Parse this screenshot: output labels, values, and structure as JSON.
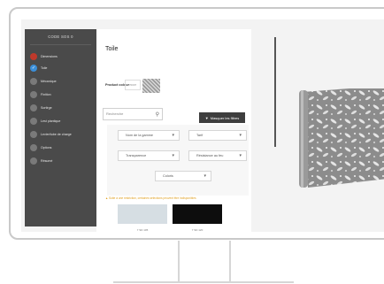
{
  "sidebar": {
    "title": "CODE SOS 0",
    "steps": [
      {
        "label": "Dimensions",
        "state": "done"
      },
      {
        "label": "Toile",
        "state": "active"
      },
      {
        "label": "Mécanique",
        "state": "todo"
      },
      {
        "label": "Finition",
        "state": "todo"
      },
      {
        "label": "Sortirge",
        "state": "todo"
      },
      {
        "label": "Lest plantique",
        "state": "todo"
      },
      {
        "label": "Levier/tube de charge",
        "state": "todo"
      },
      {
        "label": "Options",
        "state": "todo"
      },
      {
        "label": "Résumé",
        "state": "todo"
      }
    ]
  },
  "main": {
    "title": "Toile",
    "product_colour_label": "Product colour",
    "product_colour_value": "70007",
    "search_placeholder": "Recherche",
    "mask_filters_label": "Masquer les filtres",
    "filters": {
      "gamme": "Nom de la gamme",
      "tarif": "Tarif",
      "transparence": "Transparence",
      "feu": "Résistance au feu",
      "coloris": "Coloris"
    },
    "alert_text": "Suite à une restriction, certaines sélections peuvent être indisponibles",
    "fabrics": [
      {
        "label": "7 SD 105",
        "color": "#d6dee3"
      },
      {
        "label": "7 SD 120",
        "color": "#0d0d0d"
      }
    ]
  },
  "colors": {
    "sidebar": "#4a4a4a",
    "active_step": "#3b8fd9",
    "done_step": "#c0392b"
  }
}
